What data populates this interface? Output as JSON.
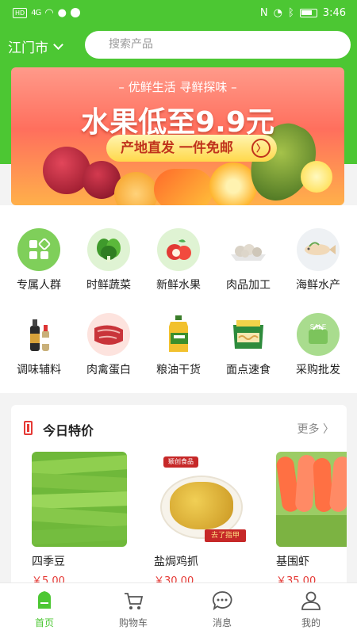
{
  "status_bar": {
    "network": "HD",
    "signal": "4G",
    "time": "3:46"
  },
  "header": {
    "city": "江门市",
    "search_placeholder": "搜索产品"
  },
  "banner": {
    "subtitle": "– 优鲜生活 寻鲜探味 –",
    "title": "水果低至9.9元",
    "cta": "产地直发 一件免邮",
    "cta_arrow": "〉"
  },
  "categories": [
    {
      "label": "专属人群",
      "icon": "grid-icon"
    },
    {
      "label": "时鲜蔬菜",
      "icon": "vegetable-icon"
    },
    {
      "label": "新鲜水果",
      "icon": "apple-icon"
    },
    {
      "label": "肉品加工",
      "icon": "meatball-icon"
    },
    {
      "label": "海鲜水产",
      "icon": "fish-icon"
    },
    {
      "label": "调味辅料",
      "icon": "sauce-icon"
    },
    {
      "label": "肉禽蛋白",
      "icon": "meat-icon"
    },
    {
      "label": "粮油干货",
      "icon": "oil-icon"
    },
    {
      "label": "面点速食",
      "icon": "noodle-icon"
    },
    {
      "label": "采购批发",
      "icon": "sale-icon"
    }
  ],
  "deals": {
    "title": "今日特价",
    "more": "更多 〉",
    "products": [
      {
        "name": "四季豆",
        "price": "￥5.00"
      },
      {
        "name": "盐焗鸡抓",
        "price": "￥30.00",
        "tag": "去了指甲",
        "brand": "颖创食品"
      },
      {
        "name": "基围虾",
        "price": "￥35.00"
      }
    ]
  },
  "tabbar": [
    {
      "label": "首页",
      "active": true
    },
    {
      "label": "购物车",
      "active": false
    },
    {
      "label": "消息",
      "active": false
    },
    {
      "label": "我的",
      "active": false
    }
  ],
  "colors": {
    "accent": "#4cc733",
    "price": "#e53935"
  }
}
